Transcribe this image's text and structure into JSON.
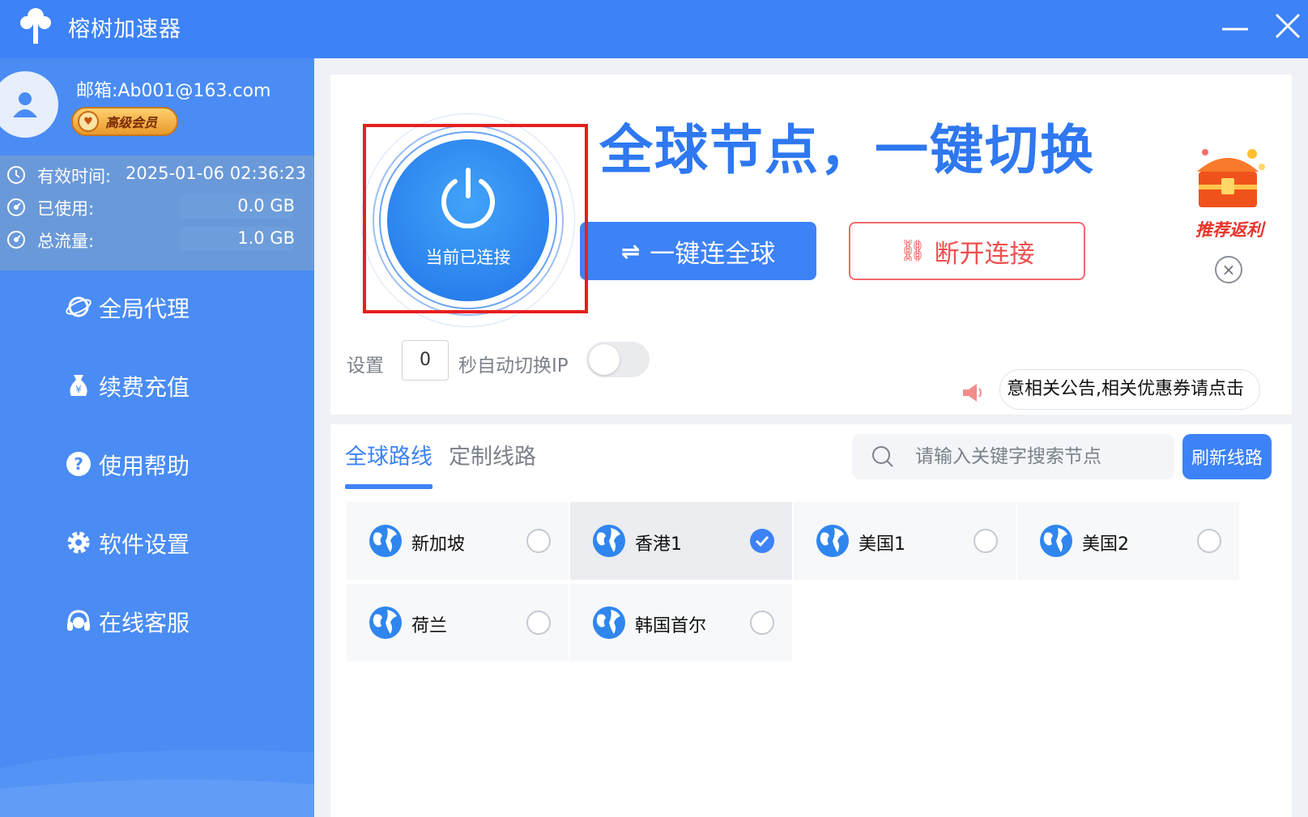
{
  "window": {
    "title": "榕树加速器",
    "logo_icon": "tree-logo-icon",
    "controls": [
      "minimize-icon",
      "close-icon"
    ]
  },
  "user": {
    "email": "邮箱:Ab001@163.com",
    "badge": "高级会员"
  },
  "stats": [
    {
      "icon": "clock-icon",
      "label": "有效时间:",
      "value": "2025-01-06 02:36:23"
    },
    {
      "icon": "gauge-icon",
      "label": "已使用:",
      "value": "0.0  GB"
    },
    {
      "icon": "gauge-icon",
      "label": "总流量:",
      "value": "1.0  GB"
    }
  ],
  "nav": [
    {
      "icon": "planet-icon",
      "label": "全局代理"
    },
    {
      "icon": "money-bag-icon",
      "label": "续费充值"
    },
    {
      "icon": "question-icon",
      "label": "使用帮助"
    },
    {
      "icon": "gear-icon",
      "label": "软件设置"
    },
    {
      "icon": "headset-icon",
      "label": "在线客服"
    }
  ],
  "connection": {
    "status": "当前已连接",
    "headline": "全球节点，一键切换",
    "connect_button": "一键连全球",
    "disconnect_button": "断开连接"
  },
  "promo": {
    "label": "推荐返利"
  },
  "auto_switch": {
    "prefix": "设置",
    "seconds": "0",
    "suffix": "秒自动切换IP",
    "enabled": false
  },
  "announcement": "意相关公告,相关优惠券请点击",
  "tabs": [
    "全球路线",
    "定制线路"
  ],
  "search": {
    "placeholder": "请输入关键字搜索节点"
  },
  "refresh_button": "刷新线路",
  "nodes": [
    {
      "name": "新加坡",
      "selected": false
    },
    {
      "name": "香港1",
      "selected": true
    },
    {
      "name": "美国1",
      "selected": false
    },
    {
      "name": "美国2",
      "selected": false
    },
    {
      "name": "荷兰",
      "selected": false
    },
    {
      "name": "韩国首尔",
      "selected": false
    }
  ],
  "colors": {
    "primary": "#3d82f6",
    "sidebar": "#4a8cf4",
    "danger": "#ee4f4f",
    "highlight": "#e81e1e"
  }
}
